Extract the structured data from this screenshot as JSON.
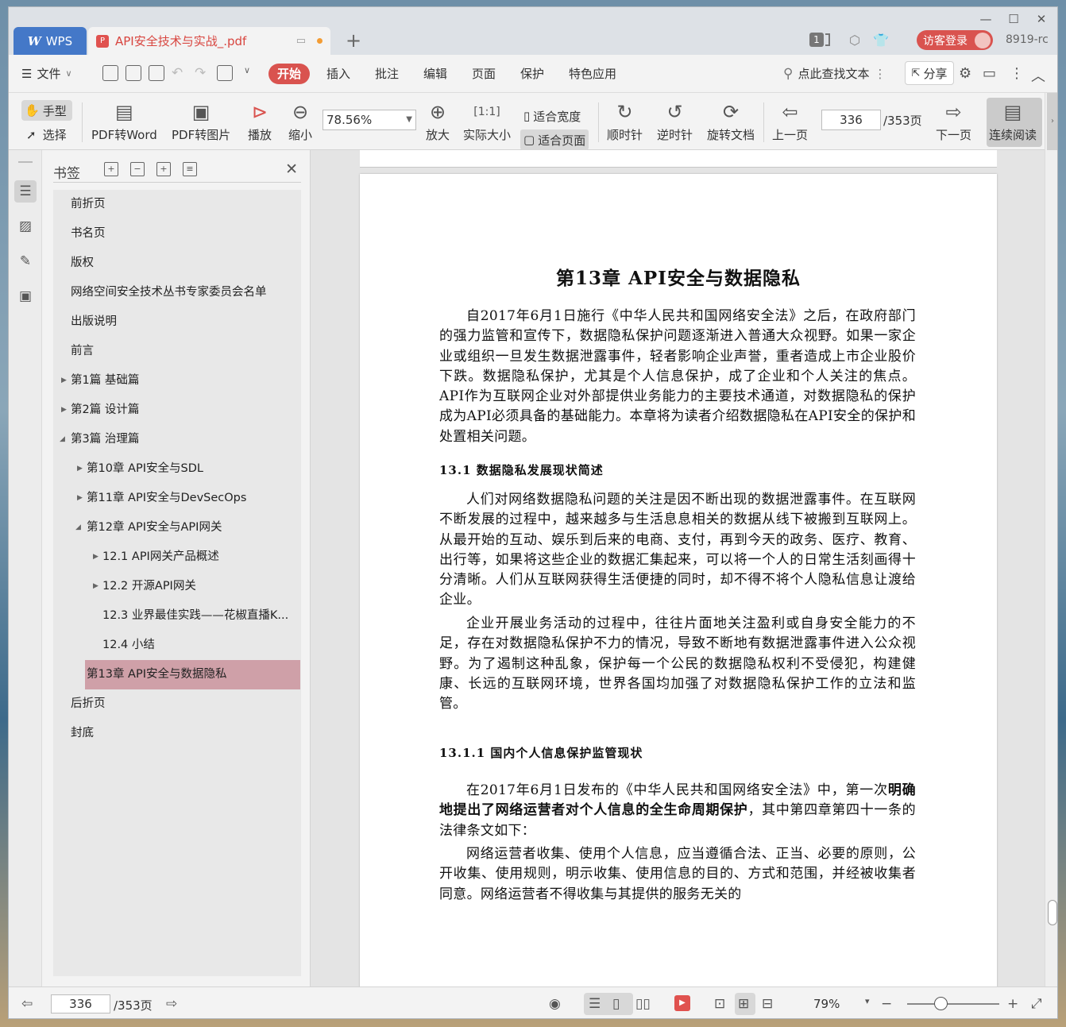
{
  "app": {
    "name": "WPS"
  },
  "tabs": {
    "document_title": "API安全技术与实战_.pdf"
  },
  "titlebar": {
    "page_badge": "1",
    "login_label": "访客登录",
    "user_label": "8919-rc"
  },
  "menu": {
    "file": "文件",
    "items": [
      "开始",
      "插入",
      "批注",
      "编辑",
      "页面",
      "保护",
      "特色应用"
    ],
    "search": "点此查找文本",
    "share": "分享"
  },
  "toolbar": {
    "hand": "手型",
    "select": "选择",
    "pdf_to_word": "PDF转Word",
    "pdf_to_image": "PDF转图片",
    "play": "播放",
    "zoom_out": "缩小",
    "zoom_value": "78.56%",
    "zoom_in": "放大",
    "actual_size": "实际大小",
    "fit_width": "适合宽度",
    "fit_page": "适合页面",
    "clockwise": "顺时针",
    "counterclockwise": "逆时针",
    "rotate_doc": "旋转文档",
    "prev_page": "上一页",
    "page_current": "336",
    "page_total": "/353页",
    "next_page": "下一页",
    "continuous_read": "连续阅读"
  },
  "bookmarks": {
    "title": "书签",
    "items": [
      {
        "label": "前折页"
      },
      {
        "label": "书名页"
      },
      {
        "label": "版权"
      },
      {
        "label": "网络空间安全技术丛书专家委员会名单"
      },
      {
        "label": "出版说明"
      },
      {
        "label": "前言"
      },
      {
        "label": "第1篇 基础篇"
      },
      {
        "label": "第2篇 设计篇"
      },
      {
        "label": "第3篇 治理篇"
      },
      {
        "label": "第10章 API安全与SDL"
      },
      {
        "label": "第11章 API安全与DevSecOps"
      },
      {
        "label": "第12章 API安全与API网关"
      },
      {
        "label": "12.1 API网关产品概述"
      },
      {
        "label": "12.2 开源API网关"
      },
      {
        "label": "12.3 业界最佳实践——花椒直播K..."
      },
      {
        "label": "12.4 小结"
      },
      {
        "label": "第13章 API安全与数据隐私"
      },
      {
        "label": "后折页"
      },
      {
        "label": "封底"
      }
    ]
  },
  "document": {
    "chapter_title": "第13章  API安全与数据隐私",
    "p1": "自2017年6月1日施行《中华人民共和国网络安全法》之后，在政府部门的强力监管和宣传下，数据隐私保护问题逐渐进入普通大众视野。如果一家企业或组织一旦发生数据泄露事件，轻者影响企业声誉，重者造成上市企业股价下跌。数据隐私保护，尤其是个人信息保护，成了企业和个人关注的焦点。API作为互联网企业对外部提供业务能力的主要技术通道，对数据隐私的保护成为API必须具备的基础能力。本章将为读者介绍数据隐私在API安全的保护和处置相关问题。",
    "sec1": "13.1  数据隐私发展现状简述",
    "p2": "人们对网络数据隐私问题的关注是因不断出现的数据泄露事件。在互联网不断发展的过程中，越来越多与生活息息相关的数据从线下被搬到互联网上。从最开始的互动、娱乐到后来的电商、支付，再到今天的政务、医疗、教育、出行等，如果将这些企业的数据汇集起来，可以将一个人的日常生活刻画得十分清晰。人们从互联网获得生活便捷的同时，却不得不将个人隐私信息让渡给企业。",
    "p3": "企业开展业务活动的过程中，往往片面地关注盈利或自身安全能力的不足，存在对数据隐私保护不力的情况，导致不断地有数据泄露事件进入公众视野。为了遏制这种乱象，保护每一个公民的数据隐私权利不受侵犯，构建健康、长远的互联网环境，世界各国均加强了对数据隐私保护工作的立法和监管。",
    "sec2": "13.1.1  国内个人信息保护监管现状",
    "p4_a": "在2017年6月1日发布的《中华人民共和国网络安全法》中，第一次",
    "p4_b": "明确地提出了网络运营者对个人信息的全生命周期保护",
    "p4_c": "，其中第四章第四十一条的法律条文如下：",
    "p5": "网络运营者收集、使用个人信息，应当遵循合法、正当、必要的原则，公开收集、使用规则，明示收集、使用信息的目的、方式和范围，并经被收集者同意。网络运营者不得收集与其提供的服务无关的"
  },
  "statusbar": {
    "page_current": "336",
    "page_total": "/353页",
    "zoom": "79%"
  },
  "colors": {
    "accent": "#d9534f",
    "wps_blue": "#4478c8",
    "bookmark_active": "#cfa0a8"
  }
}
